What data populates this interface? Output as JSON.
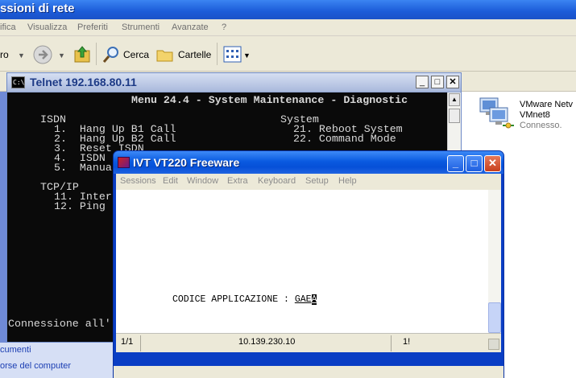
{
  "background_window": {
    "title": "ssioni di rete",
    "menu": [
      "ifica",
      "Visualizza",
      "Preferiti",
      "Strumenti",
      "Avanzate",
      "?"
    ],
    "toolbar": {
      "back_label": "ro",
      "search_label": "Cerca",
      "folders_label": "Cartelle"
    },
    "left_links": [
      "cumenti",
      "orse del computer"
    ],
    "network_connection": {
      "name": "VMware Netv",
      "device": "VMnet8",
      "status": "Connesso."
    }
  },
  "telnet": {
    "title": "Telnet 192.168.80.11",
    "icon_label": "C:\\",
    "menu_title": "Menu 24.4 - System Maintenance - Diagnostic",
    "sections": {
      "isdn": {
        "heading": "ISDN",
        "items": [
          "1.  Hang Up B1 Call",
          "2.  Hang Up B2 Call",
          "3.  Reset ISDN",
          "4.  ISDN",
          "5.  Manua"
        ]
      },
      "tcpip": {
        "heading": "TCP/IP",
        "items": [
          "11. Inter",
          "12. Ping"
        ]
      },
      "system": {
        "heading": "System",
        "items": [
          "21. Reboot System",
          "22. Command Mode"
        ]
      }
    },
    "status_line": "Connessione all'"
  },
  "ivt": {
    "title": "IVT VT220 Freeware",
    "menu": [
      "Sessions",
      "Edit",
      "Window",
      "Extra",
      "Keyboard",
      "Setup",
      "Help"
    ],
    "screen": {
      "prompt": "CODICE APPLICAZIONE : ",
      "value": "GAE",
      "cursor_char": "A"
    },
    "status": {
      "page": "1/1",
      "host": "10.139.230.10",
      "extra": "1!"
    }
  }
}
